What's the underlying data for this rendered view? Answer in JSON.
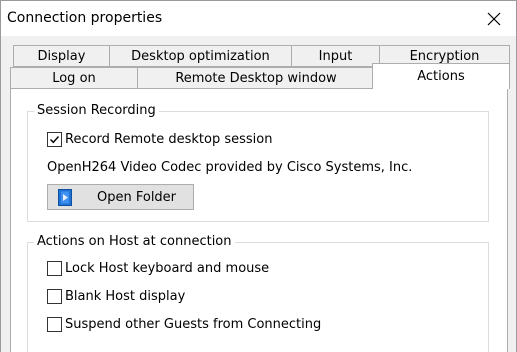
{
  "window": {
    "title": "Connection properties",
    "close_icon": "close-icon"
  },
  "tabs": {
    "row_back": [
      "Display",
      "Desktop optimization",
      "Input",
      "Encryption"
    ],
    "row_front": [
      "Log on",
      "Remote Desktop window",
      "Actions"
    ],
    "active": "Actions"
  },
  "session_recording": {
    "legend": "Session Recording",
    "record_label": "Record Remote desktop session",
    "record_checked": true,
    "codec_text": "OpenH264 Video Codec provided by Cisco Systems, Inc.",
    "open_folder_label": "Open Folder",
    "open_folder_icon": "folder-document-icon"
  },
  "host_actions": {
    "legend": "Actions on Host at connection",
    "options": [
      {
        "label": "Lock Host keyboard and mouse",
        "checked": false
      },
      {
        "label": "Blank Host display",
        "checked": false
      },
      {
        "label": "Suspend other Guests from Connecting",
        "checked": false
      }
    ]
  },
  "colors": {
    "accent_icon": "#1e73d8",
    "panel_bg": "#ffffff",
    "window_bg": "#f0f0f0"
  }
}
